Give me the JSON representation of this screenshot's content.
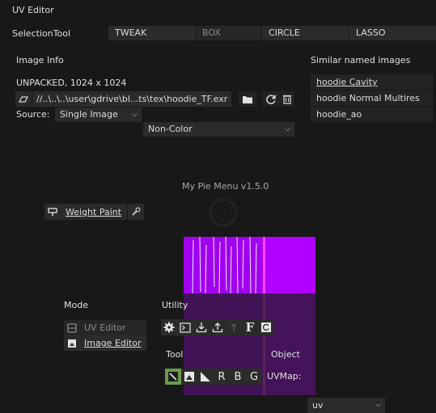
{
  "header": {
    "title": "UV Editor"
  },
  "selection_tool": {
    "label": "SelectionTool",
    "options": [
      {
        "label": "TWEAK",
        "active": true
      },
      {
        "label": "BOX",
        "active": false
      },
      {
        "label": "CIRCLE",
        "active": true
      },
      {
        "label": "LASSO",
        "active": true
      }
    ]
  },
  "image_info": {
    "title": "Image Info",
    "status": "UNPACKED, 1024 x 1024",
    "filepath": "//..\\..\\..\\user\\gdrive\\bl...ts\\tex\\hoodie_TF.exr",
    "source_label": "Source:",
    "source_value": "Single Image",
    "colorspace_value": "Non-Color"
  },
  "similar": {
    "title": "Similar named images",
    "items": [
      "hoodie Cavity",
      "hoodie Normal Multires",
      "hoodie_ao"
    ]
  },
  "pie": {
    "title": "My Pie Menu v1.5.0",
    "weight_paint_label": "Weight Paint"
  },
  "mode": {
    "title": "Mode",
    "items": [
      {
        "label": "UV Editor",
        "enabled": false
      },
      {
        "label": "Image Editor",
        "enabled": true
      }
    ]
  },
  "utility": {
    "title": "Utility"
  },
  "tool": {
    "title": "Tool",
    "letters": [
      "R",
      "B",
      "G"
    ]
  },
  "object": {
    "title": "Object",
    "uvmap_label": "UVMap:",
    "uvmap_value": "uv"
  },
  "colors": {
    "accent_purple": "#b400ff",
    "accent_pink": "#ff33ff",
    "active_green": "#6a9a4a"
  }
}
